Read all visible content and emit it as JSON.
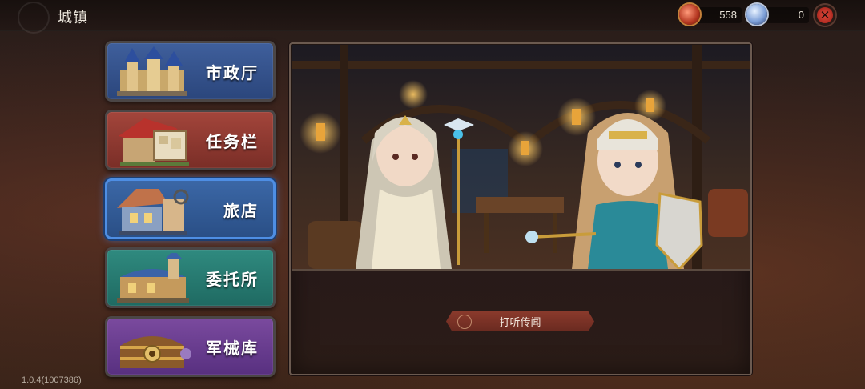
{
  "header": {
    "title": "城镇",
    "currencies": [
      {
        "icon": "gem-icon",
        "value": "558"
      },
      {
        "icon": "coin-icon",
        "value": "0"
      }
    ],
    "close_icon": "close-icon"
  },
  "menu": {
    "items": [
      {
        "label": "市政厅",
        "icon": "town-hall-icon"
      },
      {
        "label": "任务栏",
        "icon": "quest-board-icon"
      },
      {
        "label": "旅店",
        "icon": "inn-icon",
        "selected": true
      },
      {
        "label": "委托所",
        "icon": "commission-office-icon"
      },
      {
        "label": "军械库",
        "icon": "armory-chest-icon"
      }
    ]
  },
  "panel": {
    "action_button": "打听传闻"
  },
  "footer": {
    "version": "1.0.4(1007386)"
  }
}
